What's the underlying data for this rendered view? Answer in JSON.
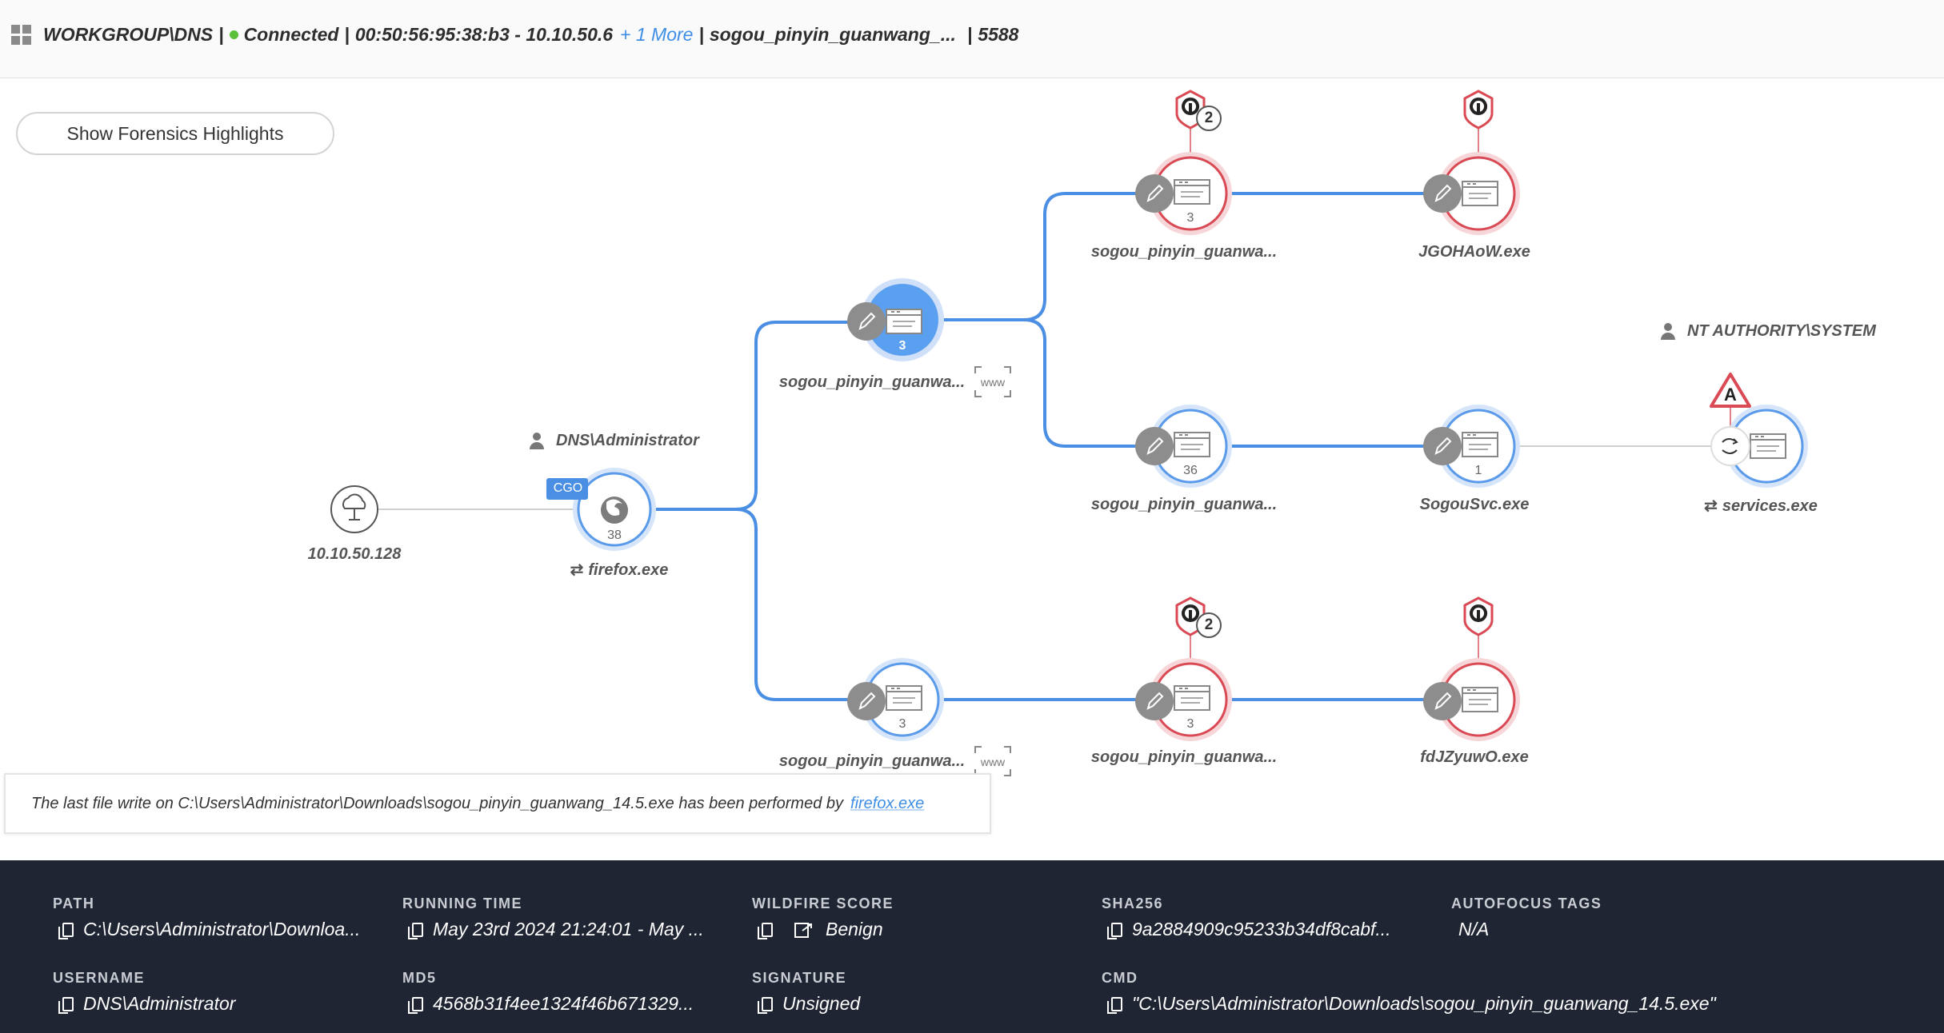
{
  "header": {
    "host": "WORKGROUP\\DNS",
    "status": "Connected",
    "address": "00:50:56:95:38:b3 - 10.10.50.6",
    "more_link": "+ 1 More",
    "process": "sogou_pinyin_guanwang_...",
    "pid": "5588"
  },
  "toggle_label": "Show Forensics Highlights",
  "graph": {
    "ip_node": "10.10.50.128",
    "user_top": "DNS\\Administrator",
    "user_right": "NT AUTHORITY\\SYSTEM",
    "cgo_badge": "CGO",
    "www_label": "www",
    "nodes": {
      "firefox": {
        "name": "firefox.exe",
        "count": "38"
      },
      "sogou_mid": {
        "name": "sogou_pinyin_guanwa...",
        "count": "3"
      },
      "sogou_top": {
        "name": "sogou_pinyin_guanwa...",
        "count": "3",
        "alerts": "2"
      },
      "jgoh": {
        "name": "JGOHAoW.exe"
      },
      "sogou_mid2": {
        "name": "sogou_pinyin_guanwa...",
        "count": "36"
      },
      "sogousvc": {
        "name": "SogouSvc.exe",
        "count": "1"
      },
      "services": {
        "name": "services.exe",
        "badge": "A"
      },
      "sogou_bot": {
        "name": "sogou_pinyin_guanwa...",
        "count": "3"
      },
      "sogou_bot2": {
        "name": "sogou_pinyin_guanwa...",
        "count": "3",
        "alerts": "2"
      },
      "fdj": {
        "name": "fdJZyuwO.exe"
      }
    },
    "colors": {
      "edge": "#4a8fe3",
      "blue_ring": "#cfe0f8",
      "red_ring": "#f4c9cc",
      "red": "#d94a55",
      "fill_active": "#5b9ff0"
    }
  },
  "info_bar": {
    "text": "The last file write on C:\\Users\\Administrator\\Downloads\\sogou_pinyin_guanwang_14.5.exe has been performed by",
    "link": "firefox.exe"
  },
  "footer": {
    "path": {
      "label": "PATH",
      "value": "C:\\Users\\Administrator\\Downloa..."
    },
    "running_time": {
      "label": "RUNNING TIME",
      "value": "May 23rd 2024 21:24:01 - May ..."
    },
    "wildfire": {
      "label": "WILDFIRE SCORE",
      "value": "Benign"
    },
    "sha256": {
      "label": "SHA256",
      "value": "9a2884909c95233b34df8cabf..."
    },
    "autofocus": {
      "label": "AUTOFOCUS TAGS",
      "value": "N/A"
    },
    "username": {
      "label": "USERNAME",
      "value": "DNS\\Administrator"
    },
    "md5": {
      "label": "MD5",
      "value": "4568b31f4ee1324f46b671329..."
    },
    "signature": {
      "label": "SIGNATURE",
      "value": "Unsigned"
    },
    "cmd": {
      "label": "CMD",
      "value": "\"C:\\Users\\Administrator\\Downloads\\sogou_pinyin_guanwang_14.5.exe\""
    }
  }
}
